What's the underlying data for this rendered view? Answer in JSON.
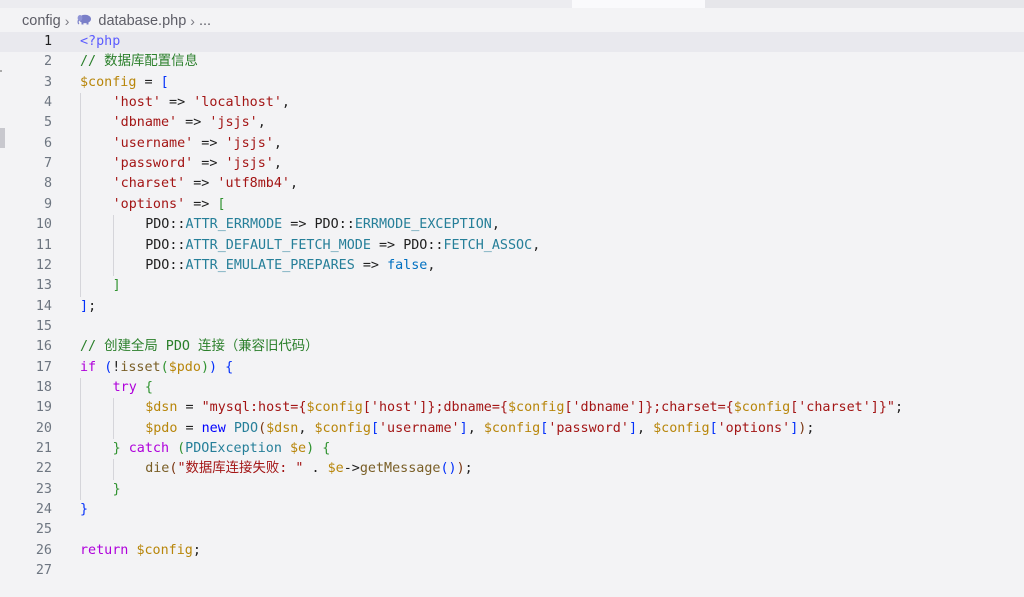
{
  "breadcrumb": {
    "folder": "config",
    "file": "database.php",
    "more": "..."
  },
  "colors": {
    "comment": "#2a7f2a",
    "variable": "#b8860b",
    "string": "#a31515",
    "keyword": "#0000ff",
    "control": "#af00db",
    "constant": "#0070c1",
    "class": "#267f99",
    "function": "#795e26"
  },
  "editor": {
    "active_line": 1,
    "lines": [
      {
        "n": "1",
        "indent": 0,
        "t": [
          [
            "<?php",
            "tag"
          ]
        ]
      },
      {
        "n": "2",
        "indent": 0,
        "t": [
          [
            "// 数据库配置信息",
            "cmt"
          ]
        ]
      },
      {
        "n": "3",
        "indent": 0,
        "t": [
          [
            "$config",
            "var"
          ],
          [
            " = ",
            "plain"
          ],
          [
            "[",
            "br"
          ]
        ]
      },
      {
        "n": "4",
        "indent": 1,
        "t": [
          [
            "'host'",
            "str"
          ],
          [
            " => ",
            "plain"
          ],
          [
            "'localhost'",
            "str"
          ],
          [
            ",",
            "plain"
          ]
        ]
      },
      {
        "n": "5",
        "indent": 1,
        "t": [
          [
            "'dbname'",
            "str"
          ],
          [
            " => ",
            "plain"
          ],
          [
            "'jsjs'",
            "str"
          ],
          [
            ",",
            "plain"
          ]
        ]
      },
      {
        "n": "6",
        "indent": 1,
        "t": [
          [
            "'username'",
            "str"
          ],
          [
            " => ",
            "plain"
          ],
          [
            "'jsjs'",
            "str"
          ],
          [
            ",",
            "plain"
          ]
        ]
      },
      {
        "n": "7",
        "indent": 1,
        "t": [
          [
            "'password'",
            "str"
          ],
          [
            " => ",
            "plain"
          ],
          [
            "'jsjs'",
            "str"
          ],
          [
            ",",
            "plain"
          ]
        ]
      },
      {
        "n": "8",
        "indent": 1,
        "t": [
          [
            "'charset'",
            "str"
          ],
          [
            " => ",
            "plain"
          ],
          [
            "'utf8mb4'",
            "str"
          ],
          [
            ",",
            "plain"
          ]
        ]
      },
      {
        "n": "9",
        "indent": 1,
        "t": [
          [
            "'options'",
            "str"
          ],
          [
            " => ",
            "plain"
          ],
          [
            "[",
            "br2"
          ]
        ]
      },
      {
        "n": "10",
        "indent": 2,
        "t": [
          [
            "PDO",
            "plain"
          ],
          [
            "::",
            "plain"
          ],
          [
            "ATTR_ERRMODE",
            "cls"
          ],
          [
            " => ",
            "plain"
          ],
          [
            "PDO",
            "plain"
          ],
          [
            "::",
            "plain"
          ],
          [
            "ERRMODE_EXCEPTION",
            "cls"
          ],
          [
            ",",
            "plain"
          ]
        ]
      },
      {
        "n": "11",
        "indent": 2,
        "t": [
          [
            "PDO",
            "plain"
          ],
          [
            "::",
            "plain"
          ],
          [
            "ATTR_DEFAULT_FETCH_MODE",
            "cls"
          ],
          [
            " => ",
            "plain"
          ],
          [
            "PDO",
            "plain"
          ],
          [
            "::",
            "plain"
          ],
          [
            "FETCH_ASSOC",
            "cls"
          ],
          [
            ",",
            "plain"
          ]
        ]
      },
      {
        "n": "12",
        "indent": 2,
        "t": [
          [
            "PDO",
            "plain"
          ],
          [
            "::",
            "plain"
          ],
          [
            "ATTR_EMULATE_PREPARES",
            "cls"
          ],
          [
            " => ",
            "plain"
          ],
          [
            "false",
            "const"
          ],
          [
            ",",
            "plain"
          ]
        ]
      },
      {
        "n": "13",
        "indent": 1,
        "t": [
          [
            "]",
            "br2"
          ]
        ]
      },
      {
        "n": "14",
        "indent": 0,
        "t": [
          [
            "]",
            "br"
          ],
          [
            ";",
            "plain"
          ]
        ]
      },
      {
        "n": "15",
        "indent": 0,
        "t": []
      },
      {
        "n": "16",
        "indent": 0,
        "t": [
          [
            "// 创建全局 PDO 连接（兼容旧代码）",
            "cmt"
          ]
        ]
      },
      {
        "n": "17",
        "indent": 0,
        "t": [
          [
            "if",
            "ctrl"
          ],
          [
            " ",
            "plain"
          ],
          [
            "(",
            "br"
          ],
          [
            "!",
            "plain"
          ],
          [
            "isset",
            "fn"
          ],
          [
            "(",
            "br2"
          ],
          [
            "$pdo",
            "var"
          ],
          [
            ")",
            "br2"
          ],
          [
            ")",
            "br"
          ],
          [
            " ",
            "plain"
          ],
          [
            "{",
            "br"
          ]
        ]
      },
      {
        "n": "18",
        "indent": 1,
        "t": [
          [
            "try",
            "ctrl"
          ],
          [
            " ",
            "plain"
          ],
          [
            "{",
            "br2"
          ]
        ]
      },
      {
        "n": "19",
        "indent": 2,
        "t": [
          [
            "$dsn",
            "var"
          ],
          [
            " = ",
            "plain"
          ],
          [
            "\"mysql:host={",
            "str"
          ],
          [
            "$config",
            "var"
          ],
          [
            "['host']",
            "str"
          ],
          [
            "}",
            "str"
          ],
          [
            ";dbname={",
            "str"
          ],
          [
            "$config",
            "var"
          ],
          [
            "['dbname']",
            "str"
          ],
          [
            "}",
            "str"
          ],
          [
            ";charset={",
            "str"
          ],
          [
            "$config",
            "var"
          ],
          [
            "['charset']",
            "str"
          ],
          [
            "}\"",
            "str"
          ],
          [
            ";",
            "plain"
          ]
        ]
      },
      {
        "n": "20",
        "indent": 2,
        "t": [
          [
            "$pdo",
            "var"
          ],
          [
            " = ",
            "plain"
          ],
          [
            "new",
            "kw"
          ],
          [
            " ",
            "plain"
          ],
          [
            "PDO",
            "cls"
          ],
          [
            "(",
            "br3"
          ],
          [
            "$dsn",
            "var"
          ],
          [
            ", ",
            "plain"
          ],
          [
            "$config",
            "var"
          ],
          [
            "[",
            "br"
          ],
          [
            "'username'",
            "str"
          ],
          [
            "]",
            "br"
          ],
          [
            ", ",
            "plain"
          ],
          [
            "$config",
            "var"
          ],
          [
            "[",
            "br"
          ],
          [
            "'password'",
            "str"
          ],
          [
            "]",
            "br"
          ],
          [
            ", ",
            "plain"
          ],
          [
            "$config",
            "var"
          ],
          [
            "[",
            "br"
          ],
          [
            "'options'",
            "str"
          ],
          [
            "]",
            "br"
          ],
          [
            ")",
            "br3"
          ],
          [
            ";",
            "plain"
          ]
        ]
      },
      {
        "n": "21",
        "indent": 1,
        "t": [
          [
            "}",
            "br2"
          ],
          [
            " ",
            "plain"
          ],
          [
            "catch",
            "ctrl"
          ],
          [
            " ",
            "plain"
          ],
          [
            "(",
            "br2"
          ],
          [
            "PDOException",
            "cls"
          ],
          [
            " ",
            "plain"
          ],
          [
            "$e",
            "var"
          ],
          [
            ")",
            "br2"
          ],
          [
            " ",
            "plain"
          ],
          [
            "{",
            "br2"
          ]
        ]
      },
      {
        "n": "22",
        "indent": 2,
        "t": [
          [
            "die",
            "fn"
          ],
          [
            "(",
            "br3"
          ],
          [
            "\"数据库连接失败: \"",
            "str"
          ],
          [
            " . ",
            "plain"
          ],
          [
            "$e",
            "var"
          ],
          [
            "->",
            "plain"
          ],
          [
            "getMessage",
            "fn"
          ],
          [
            "(",
            "br"
          ],
          [
            ")",
            "br"
          ],
          [
            ")",
            "br3"
          ],
          [
            ";",
            "plain"
          ]
        ]
      },
      {
        "n": "23",
        "indent": 1,
        "t": [
          [
            "}",
            "br2"
          ]
        ]
      },
      {
        "n": "24",
        "indent": 0,
        "t": [
          [
            "}",
            "br"
          ]
        ]
      },
      {
        "n": "25",
        "indent": 0,
        "t": []
      },
      {
        "n": "26",
        "indent": 0,
        "t": [
          [
            "return",
            "ctrl"
          ],
          [
            " ",
            "plain"
          ],
          [
            "$config",
            "var"
          ],
          [
            ";",
            "plain"
          ]
        ]
      },
      {
        "n": "27",
        "indent": 0,
        "t": []
      }
    ]
  }
}
